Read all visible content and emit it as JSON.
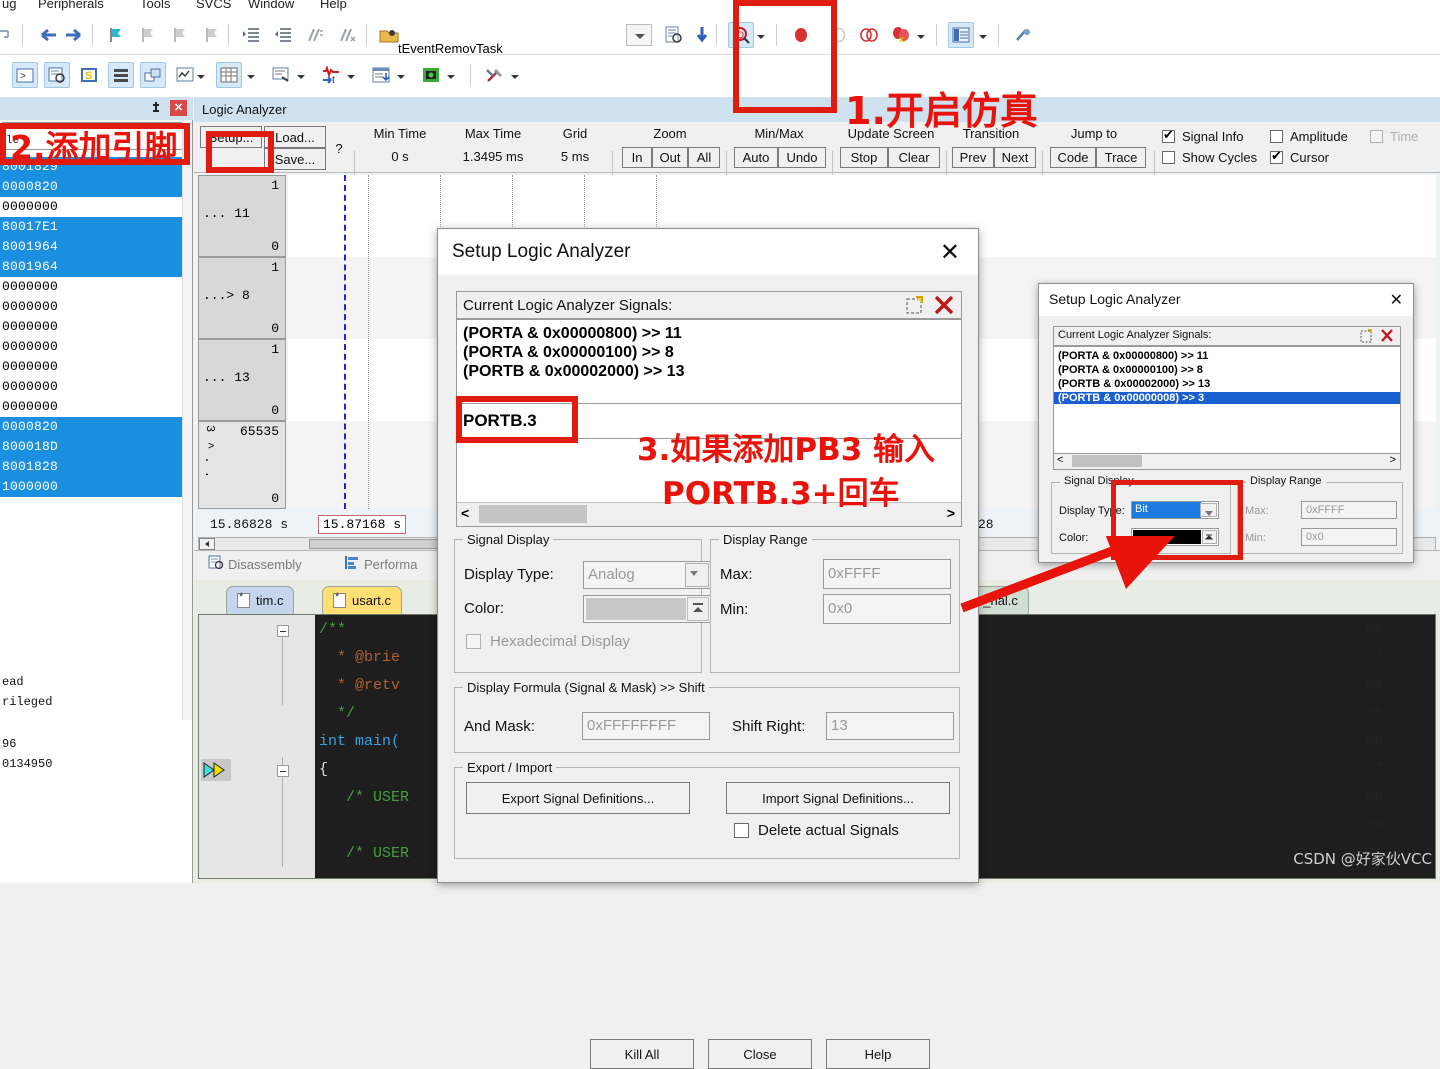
{
  "menu": {
    "items": [
      "ug",
      "Peripherals",
      "Tools",
      "SVCS",
      "Window",
      "Help"
    ]
  },
  "toolbar": {
    "task_name": "tEventRemovTask",
    "icons_row1": [
      "step-out-icon",
      "back-arrow-icon",
      "forward-arrow-icon",
      "insert-bookmark-icon",
      "prev-bookmark-icon",
      "next-bookmark-icon",
      "clear-bookmarks-icon",
      "indent-icon",
      "outdent-icon",
      "comment-icon",
      "uncomment-icon",
      "open-folder-icon"
    ],
    "icons_row2": [
      "command-window-icon",
      "disassembly-window-icon",
      "symbols-window-icon",
      "registers-window-icon",
      "call-stack-icon",
      "watch-window-icon",
      "memory-window-icon",
      "serial-window-icon",
      "analysis-icon",
      "trace-icon",
      "system-viewer-icon",
      "toolbox-icon"
    ],
    "icons_row1b": [
      "debug-session-icon",
      "download-icon",
      "run-icon",
      "magnifier-icon",
      "breakpoint-icon",
      "disable-breakpoint-icon",
      "disable-all-breakpoints-icon",
      "kill-all-breakpoints-icon",
      "watch-list-icon",
      "settings-icon"
    ]
  },
  "left_pane": {
    "field_value": "le",
    "rows": [
      {
        "text": "8001829",
        "selected": true
      },
      {
        "text": "0000820",
        "selected": true
      },
      {
        "text": "0000000",
        "selected": false
      },
      {
        "text": "80017E1",
        "selected": true
      },
      {
        "text": "8001964",
        "selected": true
      },
      {
        "text": "8001964",
        "selected": true
      },
      {
        "text": "0000000",
        "selected": false
      },
      {
        "text": "0000000",
        "selected": false
      },
      {
        "text": "0000000",
        "selected": false
      },
      {
        "text": "0000000",
        "selected": false
      },
      {
        "text": "0000000",
        "selected": false
      },
      {
        "text": "0000000",
        "selected": false
      },
      {
        "text": "0000000",
        "selected": false
      },
      {
        "text": "0000820",
        "selected": true
      },
      {
        "text": "800018D",
        "selected": true
      },
      {
        "text": "8001828",
        "selected": true
      },
      {
        "text": "1000000",
        "selected": true
      }
    ],
    "footer_lines": [
      "ead",
      "rileged",
      "96",
      "0134950"
    ]
  },
  "logic_analyzer": {
    "title": "Logic Analyzer",
    "setup_button": "Setup...",
    "load_button": "Load...",
    "save_button": "Save...",
    "help_button": "?",
    "columns": [
      {
        "label": "Min Time",
        "value": "0 s"
      },
      {
        "label": "Max Time",
        "value": "1.3495 ms"
      },
      {
        "label": "Grid",
        "value": "5 ms"
      }
    ],
    "groups": [
      {
        "label": "Zoom",
        "buttons": [
          "In",
          "Out",
          "All"
        ]
      },
      {
        "label": "Min/Max",
        "buttons": [
          "Auto",
          "Undo"
        ]
      },
      {
        "label": "Update Screen",
        "buttons": [
          "Stop",
          "Clear"
        ]
      },
      {
        "label": "Transition",
        "buttons": [
          "Prev",
          "Next"
        ]
      },
      {
        "label": "Jump to",
        "buttons": [
          "Code",
          "Trace"
        ]
      }
    ],
    "checkboxes": [
      {
        "label": "Signal Info",
        "checked": true,
        "disabled": false
      },
      {
        "label": "Amplitude",
        "checked": false,
        "disabled": false
      },
      {
        "label": "Time",
        "checked": false,
        "disabled": true
      },
      {
        "label": "Show Cycles",
        "checked": false,
        "disabled": false
      },
      {
        "label": "Cursor",
        "checked": true,
        "disabled": false
      }
    ],
    "signals": [
      {
        "top": "1",
        "mid": "...  11",
        "bot": "0"
      },
      {
        "top": "1",
        "mid": "...> 8",
        "bot": "0"
      },
      {
        "top": "1",
        "mid": "...  13",
        "bot": "0"
      },
      {
        "top": "65535",
        "mid": "",
        "bot": "0",
        "vertical": "3",
        "vmarks": "^ . ."
      }
    ],
    "time_left": "15.86828  s",
    "time_cursor": "15.87168 s",
    "time_right": ". 91828"
  },
  "debug_tabs": [
    {
      "label": "Disassembly",
      "icon": "disassembly-icon"
    },
    {
      "label": "Performa",
      "icon": "performance-icon"
    }
  ],
  "editor": {
    "tabs": [
      {
        "label": "tim.c",
        "active": false,
        "color": "#c6d4ec"
      },
      {
        "label": "usart.c",
        "active": true,
        "color": "#ffde74"
      },
      {
        "label": "1xx_hal.c",
        "active": false,
        "color": "#cfded0"
      }
    ],
    "lines": [
      {
        "num": "62",
        "code": "/**",
        "cls": "c-cmt",
        "fold": true,
        "marker": false
      },
      {
        "num": "63",
        "code": "  * @brie",
        "cls": "c-doc",
        "fold": false,
        "marker": false
      },
      {
        "num": "64",
        "code": "  * @retv",
        "cls": "c-doc",
        "fold": false,
        "marker": false
      },
      {
        "num": "65",
        "code": "  */",
        "cls": "c-cmt",
        "fold": false,
        "marker": false
      },
      {
        "num": "66",
        "code": "int main(",
        "cls": "c-kw",
        "fold": false,
        "marker": false
      },
      {
        "num": "67",
        "code": "{",
        "cls": "c-pl",
        "fold": true,
        "marker": true
      },
      {
        "num": "68",
        "code": "   /* USER",
        "cls": "c-cmt",
        "fold": false,
        "marker": false
      },
      {
        "num": "69",
        "code": "",
        "cls": "c-pl",
        "fold": false,
        "marker": false
      },
      {
        "num": "70",
        "code": "   /* USER",
        "cls": "c-cmt",
        "fold": false,
        "marker": false
      }
    ]
  },
  "dialog_main": {
    "title": "Setup Logic Analyzer",
    "close_glyph": "✕",
    "signals_label": "Current Logic Analyzer Signals:",
    "new_icon": "new-signal-icon",
    "delete_icon": "delete-signal-icon",
    "signal_items": [
      "(PORTA & 0x00000800) >> 11",
      "(PORTA & 0x00000100) >> 8",
      "(PORTB & 0x00002000) >> 13"
    ],
    "edit_value": "PORTB.3",
    "scroll_left": "<",
    "scroll_right": ">",
    "signal_display": {
      "legend": "Signal Display",
      "display_type_label": "Display Type:",
      "display_type_value": "Analog",
      "color_label": "Color:",
      "color_value": "#c8c8c8",
      "hex_label": "Hexadecimal Display",
      "hex_checked": false
    },
    "display_range": {
      "legend": "Display Range",
      "max_label": "Max:",
      "max_value": "0xFFFF",
      "min_label": "Min:",
      "min_value": "0x0"
    },
    "formula": {
      "legend": "Display Formula (Signal & Mask) >> Shift",
      "and_mask_label": "And Mask:",
      "and_mask_value": "0xFFFFFFFF",
      "shift_label": "Shift Right:",
      "shift_value": "13"
    },
    "export_import": {
      "legend": "Export / Import",
      "export_button": "Export Signal Definitions...",
      "import_button": "Import Signal Definitions...",
      "delete_checkbox": "Delete actual Signals",
      "delete_checked": false
    },
    "buttons": [
      "Kill All",
      "Close",
      "Help"
    ]
  },
  "dialog_second": {
    "title": "Setup Logic Analyzer",
    "close_glyph": "✕",
    "signals_label": "Current Logic Analyzer Signals:",
    "signal_items": [
      {
        "text": "(PORTA & 0x00000800) >> 11",
        "selected": false
      },
      {
        "text": "(PORTA & 0x00000100) >> 8",
        "selected": false
      },
      {
        "text": "(PORTB & 0x00002000) >> 13",
        "selected": false
      },
      {
        "text": "(PORTB & 0x00000008) >> 3",
        "selected": true
      }
    ],
    "signal_display": {
      "legend": "Signal Display",
      "display_type_label": "Display Type:",
      "display_type_value": "Bit",
      "color_label": "Color:",
      "color_value": "#000000"
    },
    "display_range": {
      "legend": "Display Range",
      "max_label": "Max:",
      "max_value": "0xFFFF",
      "min_label": "Min:",
      "min_value": "0x0"
    }
  },
  "annotations": {
    "step1": "1.开启仿真",
    "step2": "2.添加引脚",
    "step3_line1": "3.如果添加PB3 输入",
    "step3_line2": "PORTB.3+回车",
    "color": "#e8130a"
  },
  "watermark": "CSDN @好家伙VCC"
}
